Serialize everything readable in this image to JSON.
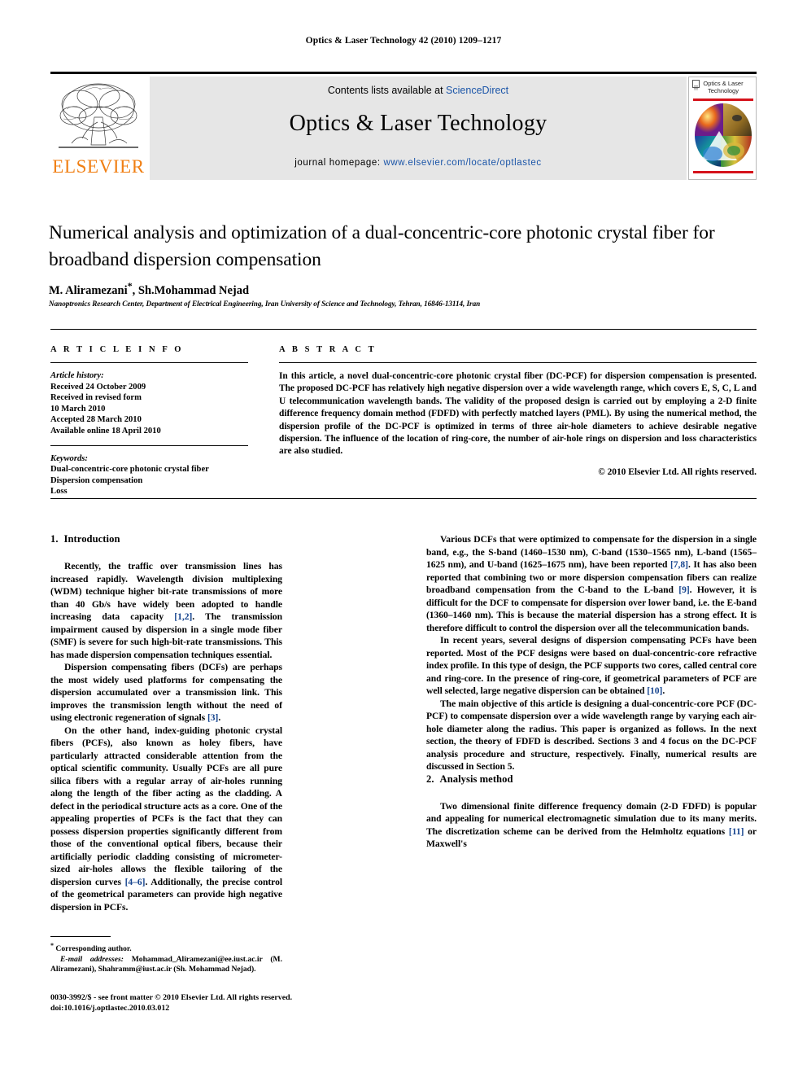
{
  "running_head": "Optics & Laser Technology 42 (2010) 1209–1217",
  "masthead": {
    "contents_prefix": "Contents lists available at ",
    "contents_link": "ScienceDirect",
    "journal_title": "Optics & Laser Technology",
    "homepage_prefix": "journal homepage: ",
    "homepage_link": "www.elsevier.com/locate/optlastec",
    "publisher": "ELSEVIER",
    "cover_title_line1": "Optics & Laser",
    "cover_title_line2": "Technology",
    "accent_red": "#d5121b",
    "accent_orange": "#f07f13",
    "link_blue": "#1b55a8",
    "band_gray": "#e6e6e6"
  },
  "article": {
    "title": "Numerical analysis and optimization of a dual-concentric-core photonic crystal fiber for broadband dispersion compensation",
    "authors": "M. Aliramezani",
    "authors_rest": ", Sh.Mohammad Nejad",
    "corresponding_mark": "*",
    "affiliation": "Nanoptronics Research Center, Department of Electrical Engineering, Iran University of Science and Technology, Tehran, 16846-13114, Iran"
  },
  "info": {
    "heading": "A R T I C L E   I N F O",
    "history_label": "Article history:",
    "history": [
      "Received 24 October 2009",
      "Received in revised form",
      "10 March 2010",
      "Accepted 28 March 2010",
      "Available online 18 April 2010"
    ],
    "keywords_label": "Keywords:",
    "keywords": [
      "Dual-concentric-core photonic crystal fiber",
      "Dispersion compensation",
      "Loss"
    ]
  },
  "abstract": {
    "heading": "A B S T R A C T",
    "text": "In this article, a novel dual-concentric-core photonic crystal fiber (DC-PCF) for dispersion compensation is presented. The proposed DC-PCF has relatively high negative dispersion over a wide wavelength range, which covers E, S, C, L and U telecommunication wavelength bands. The validity of the proposed design is carried out by employing a 2-D finite difference frequency domain method (FDFD) with perfectly matched layers (PML). By using the numerical method, the dispersion profile of the DC-PCF is optimized in terms of three air-hole diameters to achieve desirable negative dispersion. The influence of the location of ring-core, the number of air-hole rings on dispersion and loss characteristics are also studied.",
    "copyright": "© 2010 Elsevier Ltd. All rights reserved."
  },
  "body": {
    "section1": {
      "number": "1.",
      "title": "Introduction",
      "paragraphs": [
        {
          "parts": [
            {
              "t": "Recently, the traffic over transmission lines has increased rapidly. Wavelength division multiplexing (WDM) technique higher bit-rate transmissions of more than 40 Gb/s have widely been adopted to handle increasing data capacity "
            },
            {
              "t": "[1,2]",
              "ref": true
            },
            {
              "t": ". The transmission impairment caused by dispersion in a single mode fiber (SMF) is severe for such high-bit-rate transmissions. This has made dispersion compensation techniques essential."
            }
          ]
        },
        {
          "parts": [
            {
              "t": "Dispersion compensating fibers (DCFs) are perhaps the most widely used platforms for compensating the dispersion accumulated over a transmission link. This improves the transmission length without the need of using electronic regeneration of signals "
            },
            {
              "t": "[3]",
              "ref": true
            },
            {
              "t": "."
            }
          ]
        },
        {
          "parts": [
            {
              "t": "On the other hand, index-guiding photonic crystal fibers (PCFs), also known as holey fibers, have particularly attracted considerable attention from the optical scientific community. Usually PCFs are all pure silica fibers with a regular array of air-holes running along the length of the fiber acting as the cladding. A defect in the periodical structure acts as a core. One of the appealing properties of PCFs is the fact that they can possess dispersion properties significantly different from those of the conventional optical fibers, because their artificially periodic cladding consisting of micrometer-sized air-holes allows the flexible tailoring of the dispersion curves "
            },
            {
              "t": "[4–6]",
              "ref": true
            },
            {
              "t": ". Additionally, the precise control of the geometrical parameters can provide high negative dispersion in PCFs."
            }
          ]
        }
      ]
    },
    "right_paragraphs": [
      {
        "parts": [
          {
            "t": "Various DCFs that were optimized to compensate for the dispersion in a single band, e.g., the S-band (1460–1530 nm), C-band (1530–1565 nm), L-band (1565–1625 nm), and U-band (1625–1675 nm), have been reported "
          },
          {
            "t": "[7,8]",
            "ref": true
          },
          {
            "t": ". It has also been reported that combining two or more dispersion compensation fibers can realize broadband compensation from the C-band to the L-band "
          },
          {
            "t": "[9]",
            "ref": true
          },
          {
            "t": ". However, it is difficult for the DCF to compensate for dispersion over lower band, i.e. the E-band (1360–1460 nm). This is because the material dispersion has a strong effect. It is therefore difficult to control the dispersion over all the telecommunication bands."
          }
        ]
      },
      {
        "parts": [
          {
            "t": "In recent years, several designs of dispersion compensating PCFs have been reported. Most of the PCF designs were based on dual-concentric-core refractive index profile. In this type of design, the PCF supports two cores, called central core and ring-core. In the presence of ring-core, if geometrical parameters of PCF are well selected, large negative dispersion can be obtained "
          },
          {
            "t": "[10]",
            "ref": true
          },
          {
            "t": "."
          }
        ]
      },
      {
        "parts": [
          {
            "t": "The main objective of this article is designing a dual-concentric-core PCF (DC-PCF) to compensate dispersion over a wide wavelength range by varying each air-hole diameter along the radius. This paper is organized as follows. In the next section, the theory of FDFD is described. Sections 3 and 4 focus on the DC-PCF analysis procedure and structure, respectively. Finally, numerical results are discussed in Section 5."
          }
        ]
      }
    ],
    "section2": {
      "number": "2.",
      "title": "Analysis method",
      "paragraphs": [
        {
          "parts": [
            {
              "t": "Two dimensional finite difference frequency domain (2-D FDFD) is popular and appealing for numerical electromagnetic simulation due to its many merits. The discretization scheme can be derived from the Helmholtz equations "
            },
            {
              "t": "[11]",
              "ref": true
            },
            {
              "t": " or Maxwell's"
            }
          ]
        }
      ]
    }
  },
  "footnote": {
    "corresponding": "Corresponding author.",
    "email_label": "E-mail addresses:",
    "emails": "Mohammad_Aliramezani@ee.iust.ac.ir (M. Aliramezani), Shahramm@iust.ac.ir (Sh. Mohammad Nejad)."
  },
  "colophon": {
    "line1": "0030-3992/$ - see front matter © 2010 Elsevier Ltd. All rights reserved.",
    "line2": "doi:10.1016/j.optlastec.2010.03.012"
  }
}
